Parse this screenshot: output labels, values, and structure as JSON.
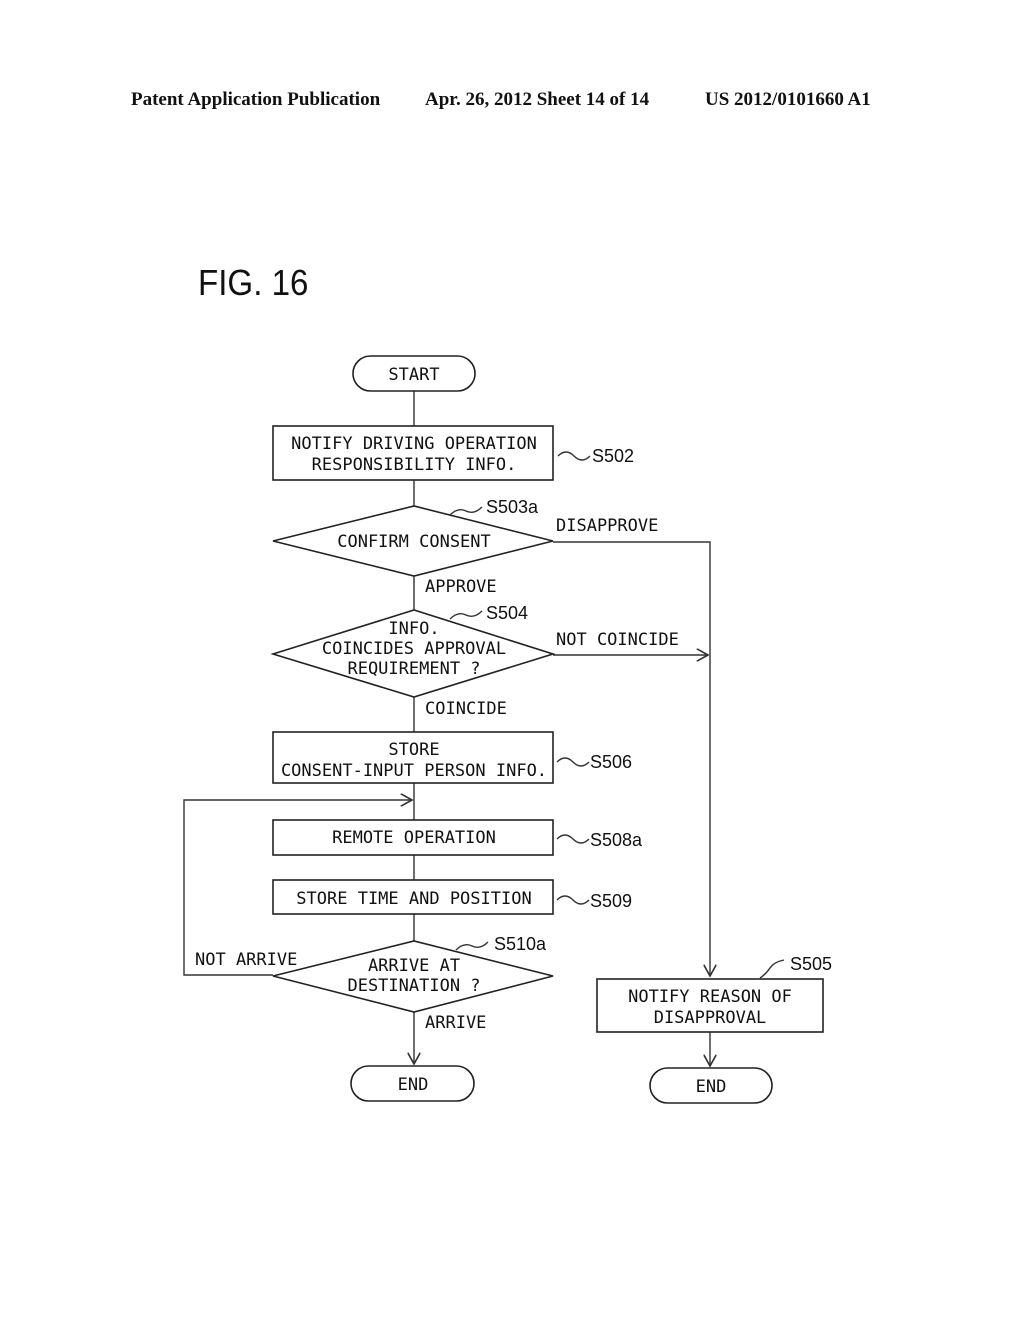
{
  "header": {
    "publication": "Patent Application Publication",
    "date_sheet": "Apr. 26, 2012  Sheet 14 of 14",
    "number": "US 2012/0101660 A1"
  },
  "figure": {
    "title": "FIG. 16",
    "nodes": {
      "start": "START",
      "s502_line1": "NOTIFY DRIVING OPERATION",
      "s502_line2": "RESPONSIBILITY INFO.",
      "s502_ref": "S502",
      "s503a_text": "CONFIRM CONSENT",
      "s503a_ref": "S503a",
      "s504_line1": "INFO.",
      "s504_line2": "COINCIDES APPROVAL",
      "s504_line3": "REQUIREMENT ?",
      "s504_ref": "S504",
      "s506_line1": "STORE",
      "s506_line2": "CONSENT-INPUT PERSON INFO.",
      "s506_ref": "S506",
      "s508a_text": "REMOTE OPERATION",
      "s508a_ref": "S508a",
      "s509_text": "STORE TIME AND POSITION",
      "s509_ref": "S509",
      "s510a_line1": "ARRIVE AT",
      "s510a_line2": "DESTINATION ?",
      "s510a_ref": "S510a",
      "s505_line1": "NOTIFY REASON OF",
      "s505_line2": "DISAPPROVAL",
      "s505_ref": "S505",
      "end_left": "END",
      "end_right": "END"
    },
    "edges": {
      "disapprove": "DISAPPROVE",
      "approve": "APPROVE",
      "not_coincide": "NOT COINCIDE",
      "coincide": "COINCIDE",
      "not_arrive": "NOT ARRIVE",
      "arrive": "ARRIVE"
    }
  }
}
